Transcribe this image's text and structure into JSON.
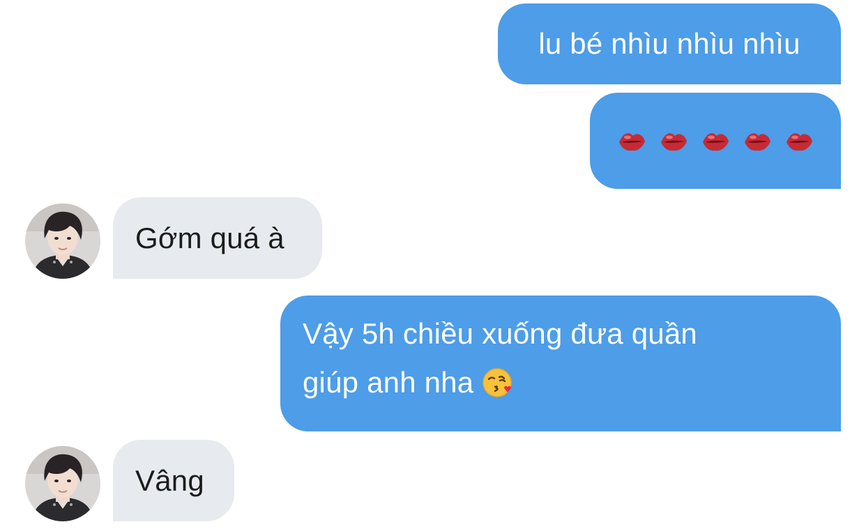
{
  "messages": [
    {
      "sender": "me",
      "text": "lu bé nhìu nhìu nhìu"
    },
    {
      "sender": "me",
      "emojis": [
        "lips-emoji",
        "lips-emoji",
        "lips-emoji",
        "lips-emoji",
        "lips-emoji"
      ]
    },
    {
      "sender": "other",
      "text": "Gớm quá à"
    },
    {
      "sender": "me",
      "line1": "Vậy 5h chiều xuống đưa quần",
      "line2": "giúp anh nha",
      "emoji": "kissing-heart-emoji"
    },
    {
      "sender": "other",
      "text": "Vâng"
    }
  ],
  "colors": {
    "outgoing_bubble": "#4d9de8",
    "incoming_bubble": "#e7eaef",
    "outgoing_text": "#ffffff",
    "incoming_text": "#1c1c1c"
  }
}
